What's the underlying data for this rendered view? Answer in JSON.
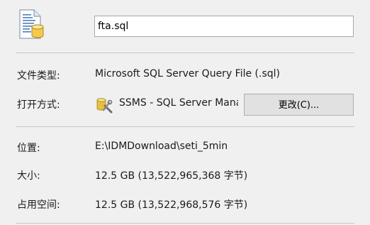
{
  "file": {
    "icon": "sql-file-icon",
    "name": "fta.sql"
  },
  "properties": {
    "type_label": "文件类型:",
    "type_value": "Microsoft SQL Server Query File (.sql)",
    "openwith_label": "打开方式:",
    "openwith_app_icon": "ssms-app-icon",
    "openwith_app": "SSMS - SQL Server Management Studio",
    "change_button": "更改(C)...",
    "location_label": "位置:",
    "location_value": "E:\\IDMDownload\\seti_5min",
    "size_label": "大小:",
    "size_value": "12.5 GB (13,522,965,368 字节)",
    "disk_size_label": "占用空间:",
    "disk_size_value": "12.5 GB (13,522,968,576 字节)"
  }
}
